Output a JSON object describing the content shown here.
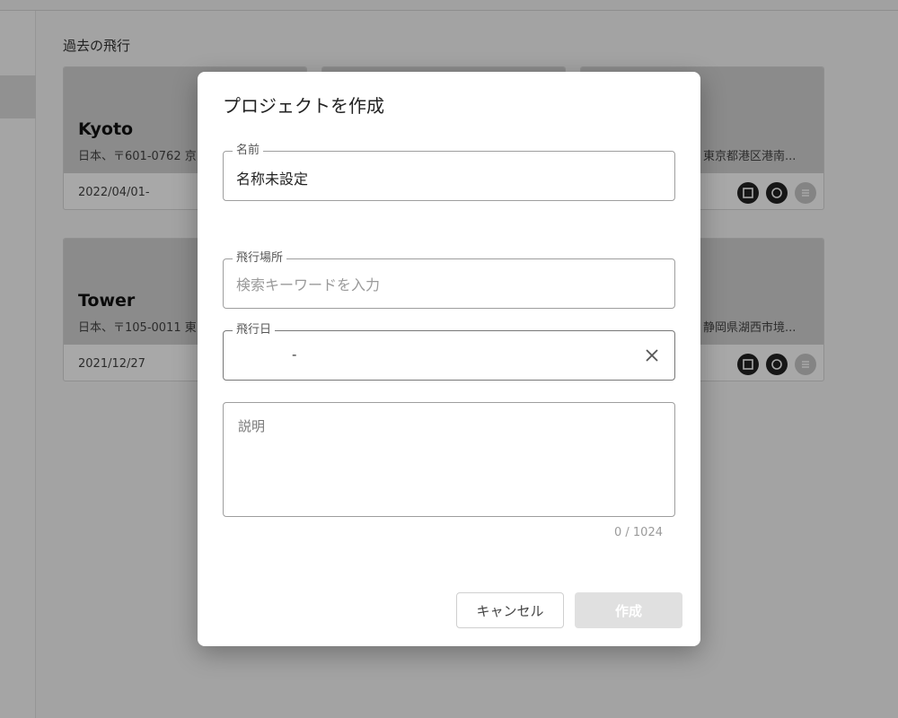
{
  "background": {
    "section_title": "過去の飛行",
    "cards": [
      {
        "name": "Kyoto",
        "address": "日本、〒601-0762 京",
        "date": "2022/04/01-"
      },
      {
        "name": "",
        "address": "",
        "date": ""
      },
      {
        "name": "",
        "address": "東京都港区港南...",
        "date": ""
      },
      {
        "name": "Tower",
        "address": "日本、〒105-0011 東",
        "date": "2021/12/27"
      },
      {
        "name": "",
        "address": "",
        "date": ""
      },
      {
        "name": "",
        "address": "静岡県湖西市境...",
        "date": ""
      }
    ]
  },
  "dialog": {
    "title": "プロジェクトを作成",
    "name_field": {
      "label": "名前",
      "value": "名称未設定"
    },
    "location_field": {
      "label": "飛行場所",
      "placeholder": "検索キーワードを入力"
    },
    "date_field": {
      "label": "飛行日",
      "separator": "-",
      "clear_icon": "close-icon"
    },
    "description_field": {
      "placeholder": "説明",
      "counter": "0 / 1024"
    },
    "buttons": {
      "cancel": "キャンセル",
      "create": "作成"
    }
  },
  "colors": {
    "overlay": "rgba(0,0,0,0.34)",
    "card_thumb": "#d4d4d4",
    "icon_dark": "#222222",
    "icon_gray": "#c8c8c8",
    "disabled_button": "#e0e0e0"
  }
}
